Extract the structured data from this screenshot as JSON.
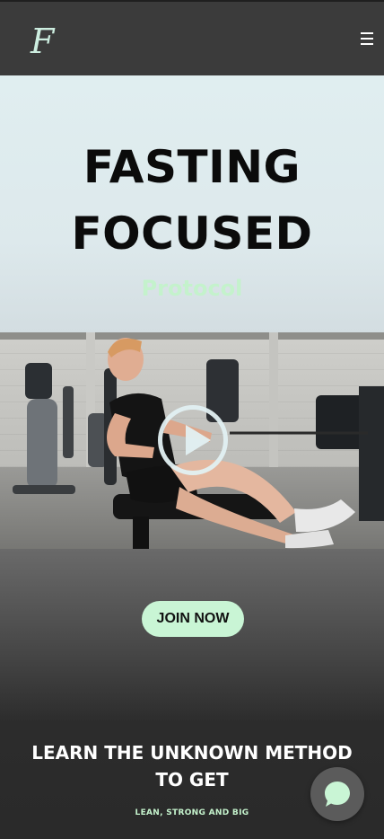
{
  "header": {
    "logo_text": "F",
    "menu_icon": "hamburger-menu-icon"
  },
  "hero": {
    "title_line1": "FASTING",
    "title_line2": "FOCUSED",
    "subtitle": "Protocol"
  },
  "video": {
    "play_icon": "play-icon"
  },
  "cta": {
    "join_label": "JOIN NOW"
  },
  "promo": {
    "headline": "LEARN THE UNKNOWN METHOD TO GET",
    "tagline": "LEAN, STRONG AND BIG"
  },
  "chat": {
    "icon": "chat-bubble-icon"
  },
  "colors": {
    "accent_mint": "#c9f5d5",
    "subtitle_mint": "#c4f2cc",
    "header_bg": "#3b3b3b",
    "hero_bg": "#e0eef0"
  }
}
